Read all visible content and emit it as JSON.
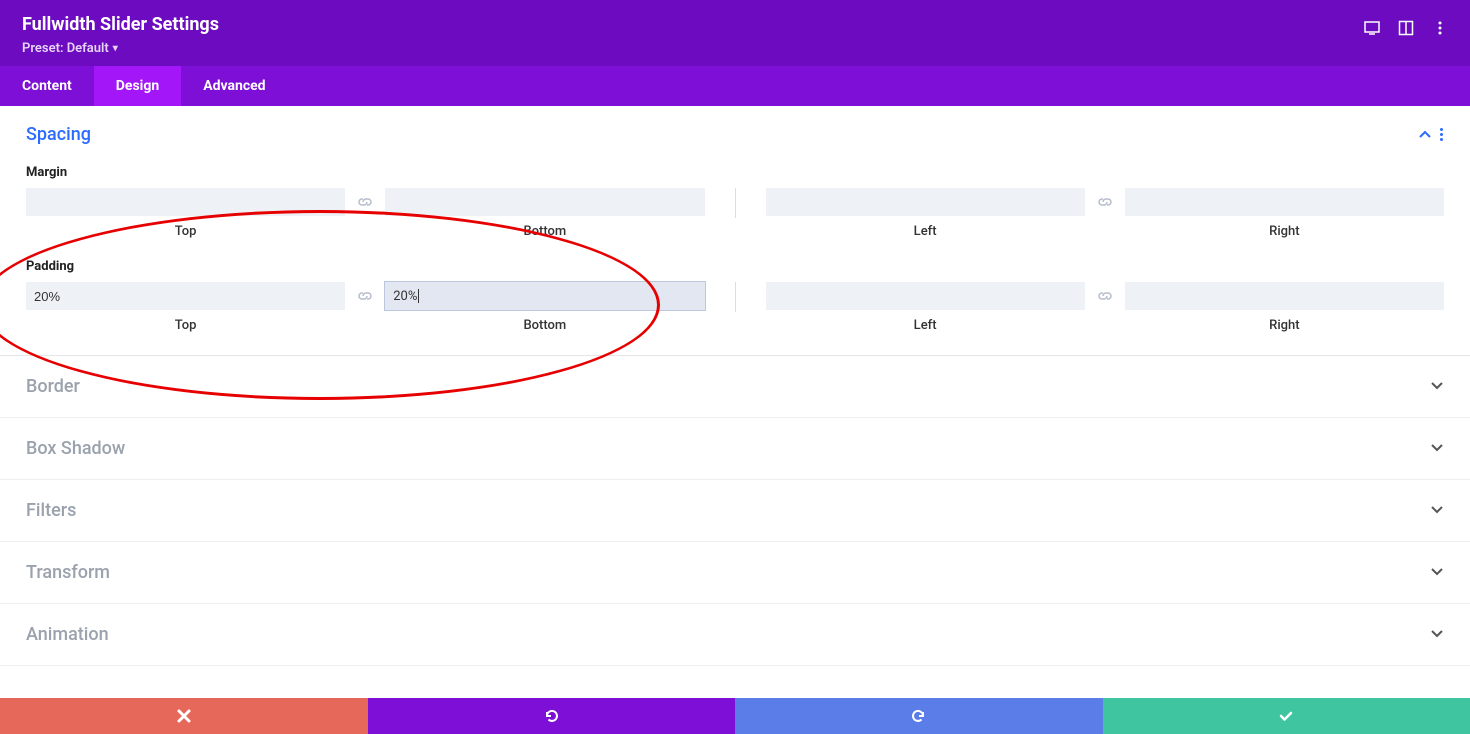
{
  "header": {
    "title": "Fullwidth Slider Settings",
    "preset": "Preset: Default"
  },
  "tabs": {
    "content": "Content",
    "design": "Design",
    "advanced": "Advanced"
  },
  "spacing": {
    "title": "Spacing",
    "margin_label": "Margin",
    "padding_label": "Padding",
    "labels": {
      "top": "Top",
      "bottom": "Bottom",
      "left": "Left",
      "right": "Right"
    },
    "margin": {
      "top": "",
      "bottom": "",
      "left": "",
      "right": ""
    },
    "padding": {
      "top": "20%",
      "bottom": "20%",
      "left": "",
      "right": ""
    }
  },
  "sections": {
    "border": "Border",
    "box_shadow": "Box Shadow",
    "filters": "Filters",
    "transform": "Transform",
    "animation": "Animation"
  }
}
